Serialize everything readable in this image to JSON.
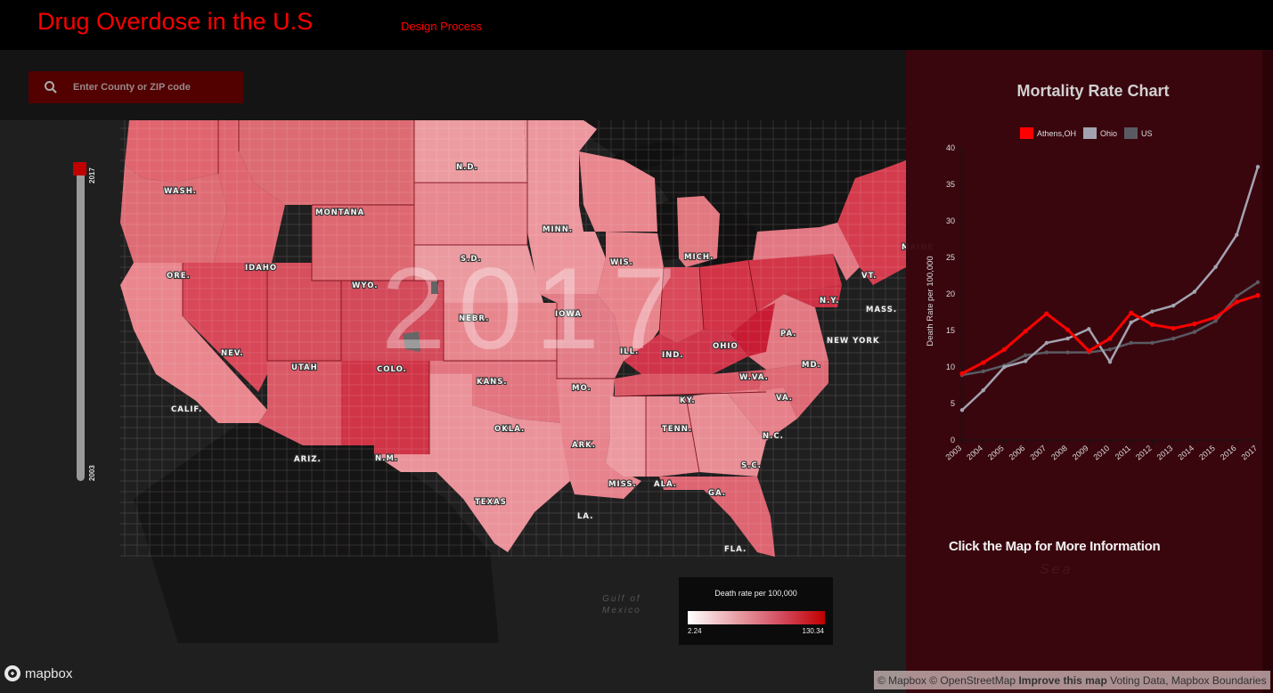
{
  "header": {
    "title": "Drug Overdose in the U.S",
    "nav_link": "Design Process"
  },
  "search": {
    "placeholder": "Enter County or ZIP code",
    "value": ""
  },
  "year_slider": {
    "min_label": "2003",
    "max_label": "2017",
    "min": 2003,
    "max": 2017,
    "value": 2017
  },
  "map": {
    "year_overlay": "2017",
    "water_label_line1": "Gulf of",
    "water_label_line2": "Mexico",
    "state_labels": [
      "WASH.",
      "MONTANA",
      "N.D.",
      "MINN.",
      "ORE.",
      "IDAHO",
      "S.D.",
      "WYO.",
      "WIS.",
      "MICH.",
      "NEBR.",
      "IOWA",
      "N.Y.",
      "VT.",
      "MASS.",
      "NEV.",
      "UTAH",
      "COLO.",
      "ILL.",
      "IND.",
      "OHIO",
      "PA.",
      "NEW YORK",
      "MD.",
      "W.VA.",
      "VA.",
      "KANS.",
      "MO.",
      "KY.",
      "CALIF.",
      "TENN.",
      "N.C.",
      "OKLA.",
      "ARK.",
      "ARIZ.",
      "N.M.",
      "S.C.",
      "MISS.",
      "ALA.",
      "GA.",
      "TEXAS",
      "LA.",
      "FLA.",
      "MAINE"
    ],
    "legend": {
      "title": "Death rate per 100,000",
      "min_label": "2.24",
      "max_label": "130.34",
      "color_low": "#ffffff",
      "color_high": "#c00000"
    },
    "attribution": {
      "mapbox": "© Mapbox",
      "osm": "© OpenStreetMap",
      "improve": "Improve this map",
      "extra": "Voting Data, Mapbox Boundaries"
    },
    "logo": "mapbox"
  },
  "panel": {
    "title": "Mortality Rate Chart",
    "click_info": "Click the Map for More Information",
    "background_label": "Sea"
  },
  "chart_data": {
    "type": "line",
    "title": "Mortality Rate Chart",
    "xlabel": "",
    "ylabel": "Death Rate per 100,000",
    "ylim": [
      0,
      40
    ],
    "yticks": [
      0,
      5,
      10,
      15,
      20,
      25,
      30,
      35,
      40
    ],
    "x": [
      "2003",
      "2004",
      "2005",
      "2006",
      "2007",
      "2008",
      "2009",
      "2010",
      "2011",
      "2012",
      "2013",
      "2014",
      "2015",
      "2016",
      "2017"
    ],
    "legend_position": "top-center",
    "grid": false,
    "series": [
      {
        "name": "Athens,OH",
        "color": "#ff0000",
        "values": [
          9.1,
          10.6,
          12.4,
          14.9,
          17.3,
          15.1,
          12.2,
          13.9,
          17.4,
          15.8,
          15.3,
          15.9,
          16.8,
          18.9,
          19.8
        ]
      },
      {
        "name": "Ohio",
        "color": "#a3a3b0",
        "values": [
          4.1,
          6.8,
          10.0,
          10.8,
          13.3,
          13.9,
          15.2,
          10.7,
          16.1,
          17.6,
          18.4,
          20.3,
          23.7,
          28.1,
          37.4
        ]
      },
      {
        "name": "US",
        "color": "#5a5a62",
        "values": [
          8.9,
          9.4,
          10.2,
          11.6,
          12.0,
          12.0,
          12.0,
          12.4,
          13.3,
          13.3,
          13.9,
          14.8,
          16.3,
          19.7,
          21.6
        ]
      }
    ]
  }
}
